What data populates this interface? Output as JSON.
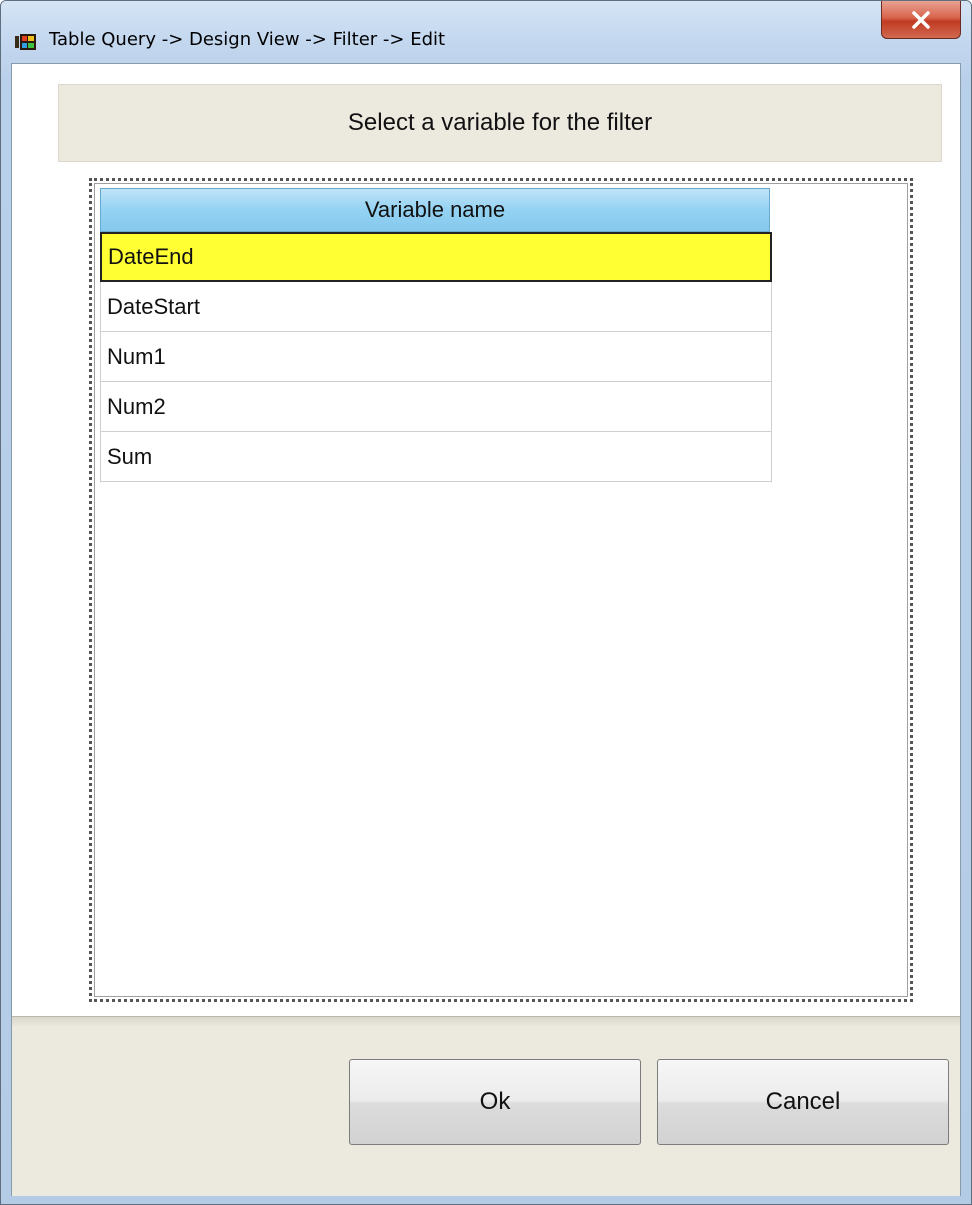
{
  "window": {
    "title": "Table Query -> Design View -> Filter -> Edit",
    "app_icon": "table-app-icon",
    "close_icon": "close-x-icon"
  },
  "header": {
    "prompt": "Select a variable for the filter"
  },
  "grid": {
    "column_header": "Variable name",
    "rows": [
      "DateEnd",
      "DateStart",
      "Num1",
      "Num2",
      "Sum"
    ],
    "selected_row": "DateEnd",
    "selected_color": "#ffff33"
  },
  "buttons": {
    "ok_label": "Ok",
    "cancel_label": "Cancel"
  }
}
